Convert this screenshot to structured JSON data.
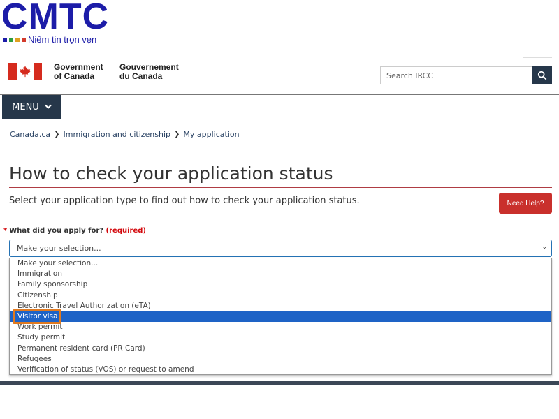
{
  "watermark": {
    "brand": "CMTC",
    "tagline": "Niềm tin trọn vẹn",
    "dot_colors": [
      "#1c1ca8",
      "#2e9e3e",
      "#e0a020",
      "#d33a2c"
    ]
  },
  "header": {
    "signature_en_line1": "Government",
    "signature_en_line2": "of Canada",
    "signature_fr_line1": "Gouvernement",
    "signature_fr_line2": "du Canada",
    "search_placeholder": "Search IRCC",
    "menu_label": "MENU"
  },
  "breadcrumb": {
    "items": [
      "Canada.ca",
      "Immigration and citizenship",
      "My application"
    ]
  },
  "main": {
    "title": "How to check your application status",
    "lead": "Select your application type to find out how to check your application status.",
    "help_button": "Need Help?",
    "question_label": "What did you apply for?",
    "question_required": "(required)",
    "select_value": "Make your selection...",
    "options": [
      "Make your selection...",
      "Immigration",
      "Family sponsorship",
      "Citizenship",
      "Electronic Travel Authorization (eTA)",
      "Visitor visa",
      "Work permit",
      "Study permit",
      "Permanent resident card (PR Card)",
      "Refugees",
      "Verification of status (VOS) or request to amend"
    ],
    "highlighted_option": "Visitor visa"
  },
  "colors": {
    "gov_dark": "#26374a",
    "flag_red": "#d52b1e",
    "help_red": "#c9302c",
    "active_blue": "#1e63c6",
    "highlight_orange": "#e07a20"
  }
}
